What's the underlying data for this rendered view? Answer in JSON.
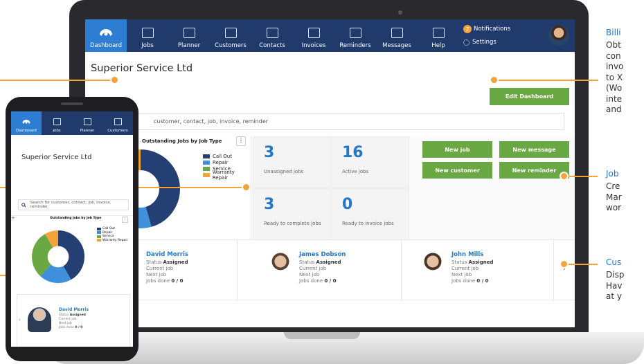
{
  "nav": {
    "items": [
      {
        "label": "Dashboard"
      },
      {
        "label": "Jobs"
      },
      {
        "label": "Planner"
      },
      {
        "label": "Customers"
      },
      {
        "label": "Contacts"
      },
      {
        "label": "Invoices"
      },
      {
        "label": "Reminders"
      },
      {
        "label": "Messages"
      },
      {
        "label": "Help"
      }
    ],
    "notifications_count": "7",
    "notifications_label": "Notifications",
    "settings_label": "Settings"
  },
  "page": {
    "company": "Superior Service Ltd",
    "edit_dashboard": "Edit Dashboard",
    "search_placeholder": "customer, contact, job, invoice, reminder"
  },
  "chart": {
    "title": "Outstanding Jobs by Job Type",
    "menu": "⋮",
    "legend": [
      "Call Out",
      "Repair",
      "Service",
      "Warranty Repair"
    ],
    "colors": {
      "call_out": "#233f74",
      "repair": "#3f8fdc",
      "service": "#6aa843",
      "warranty": "#f2a33a"
    }
  },
  "stats": [
    {
      "value": "3",
      "label": "Unassigned jobs"
    },
    {
      "value": "16",
      "label": "Active jobs"
    },
    {
      "value": "3",
      "label": "Ready to complete jobs"
    },
    {
      "value": "0",
      "label": "Ready to invoice jobs"
    }
  ],
  "actions": [
    "New job",
    "New message",
    "New customer",
    "New reminder"
  ],
  "people": [
    {
      "name": "David Morris",
      "status_label": "Status",
      "status": "Assigned",
      "current": "Current job",
      "next": "Next job",
      "done_label": "Jobs done",
      "done": "0 / 0"
    },
    {
      "name": "James Dobson",
      "status_label": "Status",
      "status": "Assigned",
      "current": "Current job",
      "next": "Next job",
      "done_label": "Jobs done",
      "done": "0 / 0"
    },
    {
      "name": "John Mills",
      "status_label": "Status",
      "status": "Assigned",
      "current": "Current job",
      "next": "Next job",
      "done_label": "Jobs done",
      "done": "0 / 0"
    }
  ],
  "pager_arrow": "›",
  "callouts": {
    "billing": {
      "title": "Billi",
      "lines": [
        "Obt",
        "con",
        "invo",
        "to X",
        "(Wo",
        "inte",
        "and"
      ]
    },
    "jobs": {
      "title": "Job",
      "lines": [
        "Cre",
        "Mar",
        "wor"
      ]
    },
    "customers": {
      "title": "Cus",
      "lines": [
        "Disp",
        "Hav",
        "at y"
      ]
    }
  },
  "phone": {
    "nav": [
      {
        "label": "Dashboard"
      },
      {
        "label": "Jobs"
      },
      {
        "label": "Planner"
      },
      {
        "label": "Customers"
      }
    ],
    "company": "Superior Service Ltd",
    "search_placeholder": "Search for customer, contact, job, invoice, reminder",
    "chart_title": "Outstanding Jobs by Job Type",
    "plus": "+",
    "person": {
      "name": "David Morris",
      "status_label": "Status",
      "status": "Assigned",
      "current": "Current job",
      "next": "Next job",
      "done_label": "Jobs done",
      "done": "0 / 0"
    },
    "arrow": "‹"
  }
}
